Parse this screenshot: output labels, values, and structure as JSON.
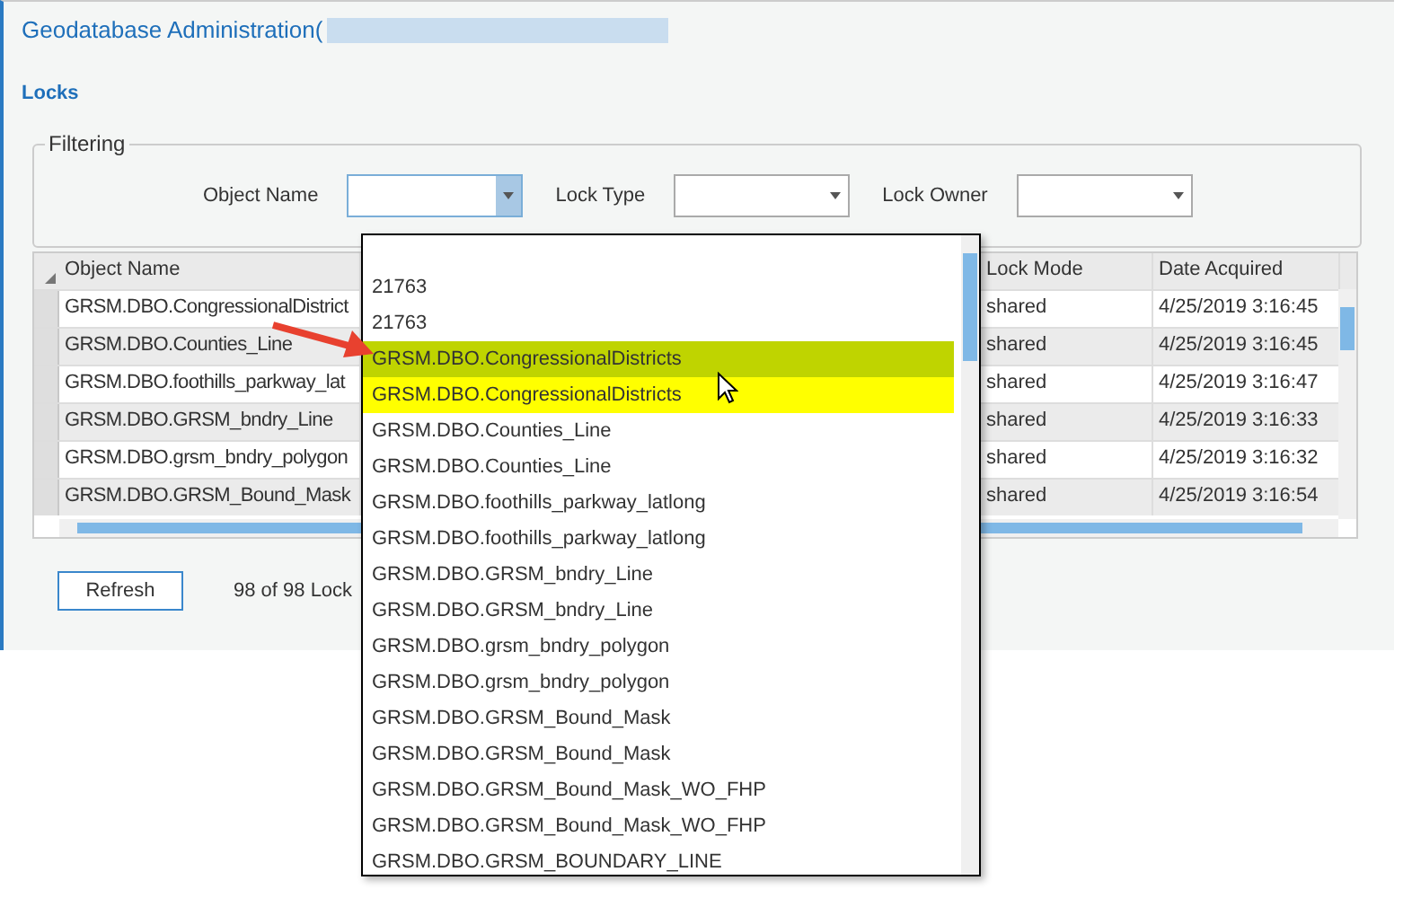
{
  "window": {
    "title": "Geodatabase Administration("
  },
  "section": "Locks",
  "filtering": {
    "legend": "Filtering",
    "filters": [
      {
        "label": "Object Name",
        "open": true
      },
      {
        "label": "Lock Type",
        "open": false
      },
      {
        "label": "Lock Owner",
        "open": false
      }
    ]
  },
  "table": {
    "columns": [
      "Object Name",
      "Lock Mode",
      "Date Acquired"
    ],
    "rows": [
      {
        "object_name": "GRSM.DBO.CongressionalDistrict",
        "lock_mode": "shared",
        "date_acquired": "4/25/2019 3:16:45"
      },
      {
        "object_name": "GRSM.DBO.Counties_Line",
        "lock_mode": "shared",
        "date_acquired": "4/25/2019 3:16:45"
      },
      {
        "object_name": "GRSM.DBO.foothills_parkway_lat",
        "lock_mode": "shared",
        "date_acquired": "4/25/2019 3:16:47"
      },
      {
        "object_name": "GRSM.DBO.GRSM_bndry_Line",
        "lock_mode": "shared",
        "date_acquired": "4/25/2019 3:16:33"
      },
      {
        "object_name": "GRSM.DBO.grsm_bndry_polygon",
        "lock_mode": "shared",
        "date_acquired": "4/25/2019 3:16:32"
      },
      {
        "object_name": "GRSM.DBO.GRSM_Bound_Mask",
        "lock_mode": "shared",
        "date_acquired": "4/25/2019 3:16:54"
      }
    ]
  },
  "refresh_button": "Refresh",
  "lock_count": "98 of 98 Lock",
  "dropdown": {
    "items": [
      {
        "label": "21763"
      },
      {
        "label": "21763"
      },
      {
        "label": "GRSM.DBO.CongressionalDistricts",
        "color": "#bfd400"
      },
      {
        "label": "GRSM.DBO.CongressionalDistricts",
        "color": "#ffff00"
      },
      {
        "label": "GRSM.DBO.Counties_Line"
      },
      {
        "label": "GRSM.DBO.Counties_Line"
      },
      {
        "label": "GRSM.DBO.foothills_parkway_latlong"
      },
      {
        "label": "GRSM.DBO.foothills_parkway_latlong"
      },
      {
        "label": "GRSM.DBO.GRSM_bndry_Line"
      },
      {
        "label": "GRSM.DBO.GRSM_bndry_Line"
      },
      {
        "label": "GRSM.DBO.grsm_bndry_polygon"
      },
      {
        "label": "GRSM.DBO.grsm_bndry_polygon"
      },
      {
        "label": "GRSM.DBO.GRSM_Bound_Mask"
      },
      {
        "label": "GRSM.DBO.GRSM_Bound_Mask"
      },
      {
        "label": "GRSM.DBO.GRSM_Bound_Mask_WO_FHP"
      },
      {
        "label": "GRSM.DBO.GRSM_Bound_Mask_WO_FHP"
      },
      {
        "label": "GRSM.DBO.GRSM_BOUNDARY_LINE"
      }
    ]
  }
}
